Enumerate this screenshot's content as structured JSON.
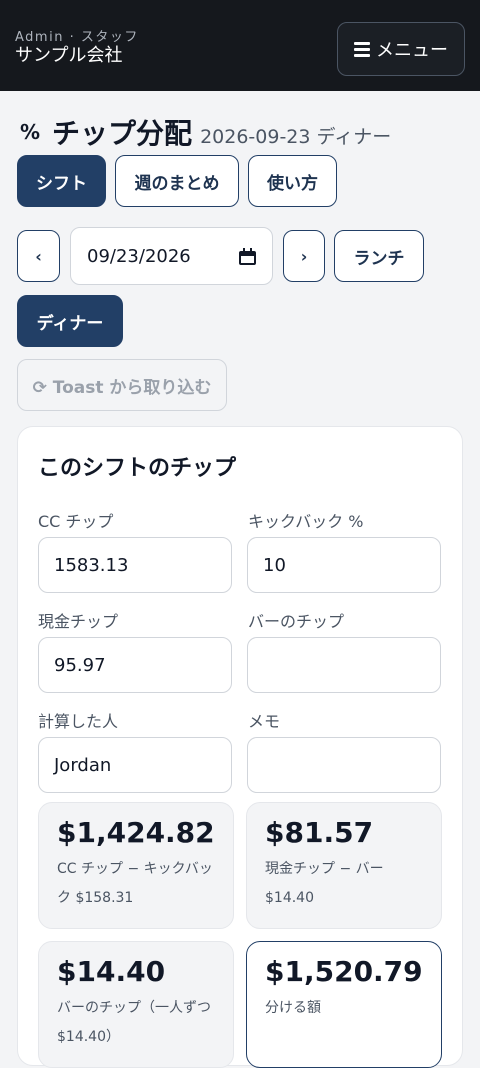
{
  "header": {
    "subtitle": "Admin · スタッフ",
    "company": "サンプル会社",
    "menu_label": "メニュー"
  },
  "page": {
    "title": "チップ分配",
    "subtitle": "2026-09-23 ディナー"
  },
  "tabs": {
    "shift": "シフト",
    "weekly": "週のまとめ",
    "howto": "使い方",
    "active": "shift"
  },
  "date_nav": {
    "prev": "‹",
    "date_value": "09/23/2026",
    "next": "›",
    "lunch": "ランチ",
    "dinner": "ディナー",
    "selected_meal": "dinner"
  },
  "import_button": "⟳ Toast から取り込む",
  "card": {
    "title": "このシフトのチップ",
    "fields": {
      "cc_tips": {
        "label": "CC チップ",
        "value": "1583.13"
      },
      "kickback": {
        "label": "キックバック %",
        "value": "10"
      },
      "cash_tips": {
        "label": "現金チップ",
        "value": "95.97"
      },
      "bar_tips": {
        "label": "バーのチップ",
        "value": ""
      },
      "calculated_by": {
        "label": "計算した人",
        "value": "Jordan"
      },
      "memo": {
        "label": "メモ",
        "value": ""
      }
    },
    "stats": [
      {
        "value": "$1,424.82",
        "desc": "CC チップ − キックバック $158.31"
      },
      {
        "value": "$81.57",
        "desc": "現金チップ − バー $14.40"
      },
      {
        "value": "$14.40",
        "desc": "バーのチップ（一人ずつ $14.40）"
      },
      {
        "value": "$1,520.79",
        "desc": "分ける額"
      }
    ]
  },
  "colors": {
    "topbar": "#15181d",
    "primary": "#223f66",
    "background": "#f3f4f6"
  }
}
